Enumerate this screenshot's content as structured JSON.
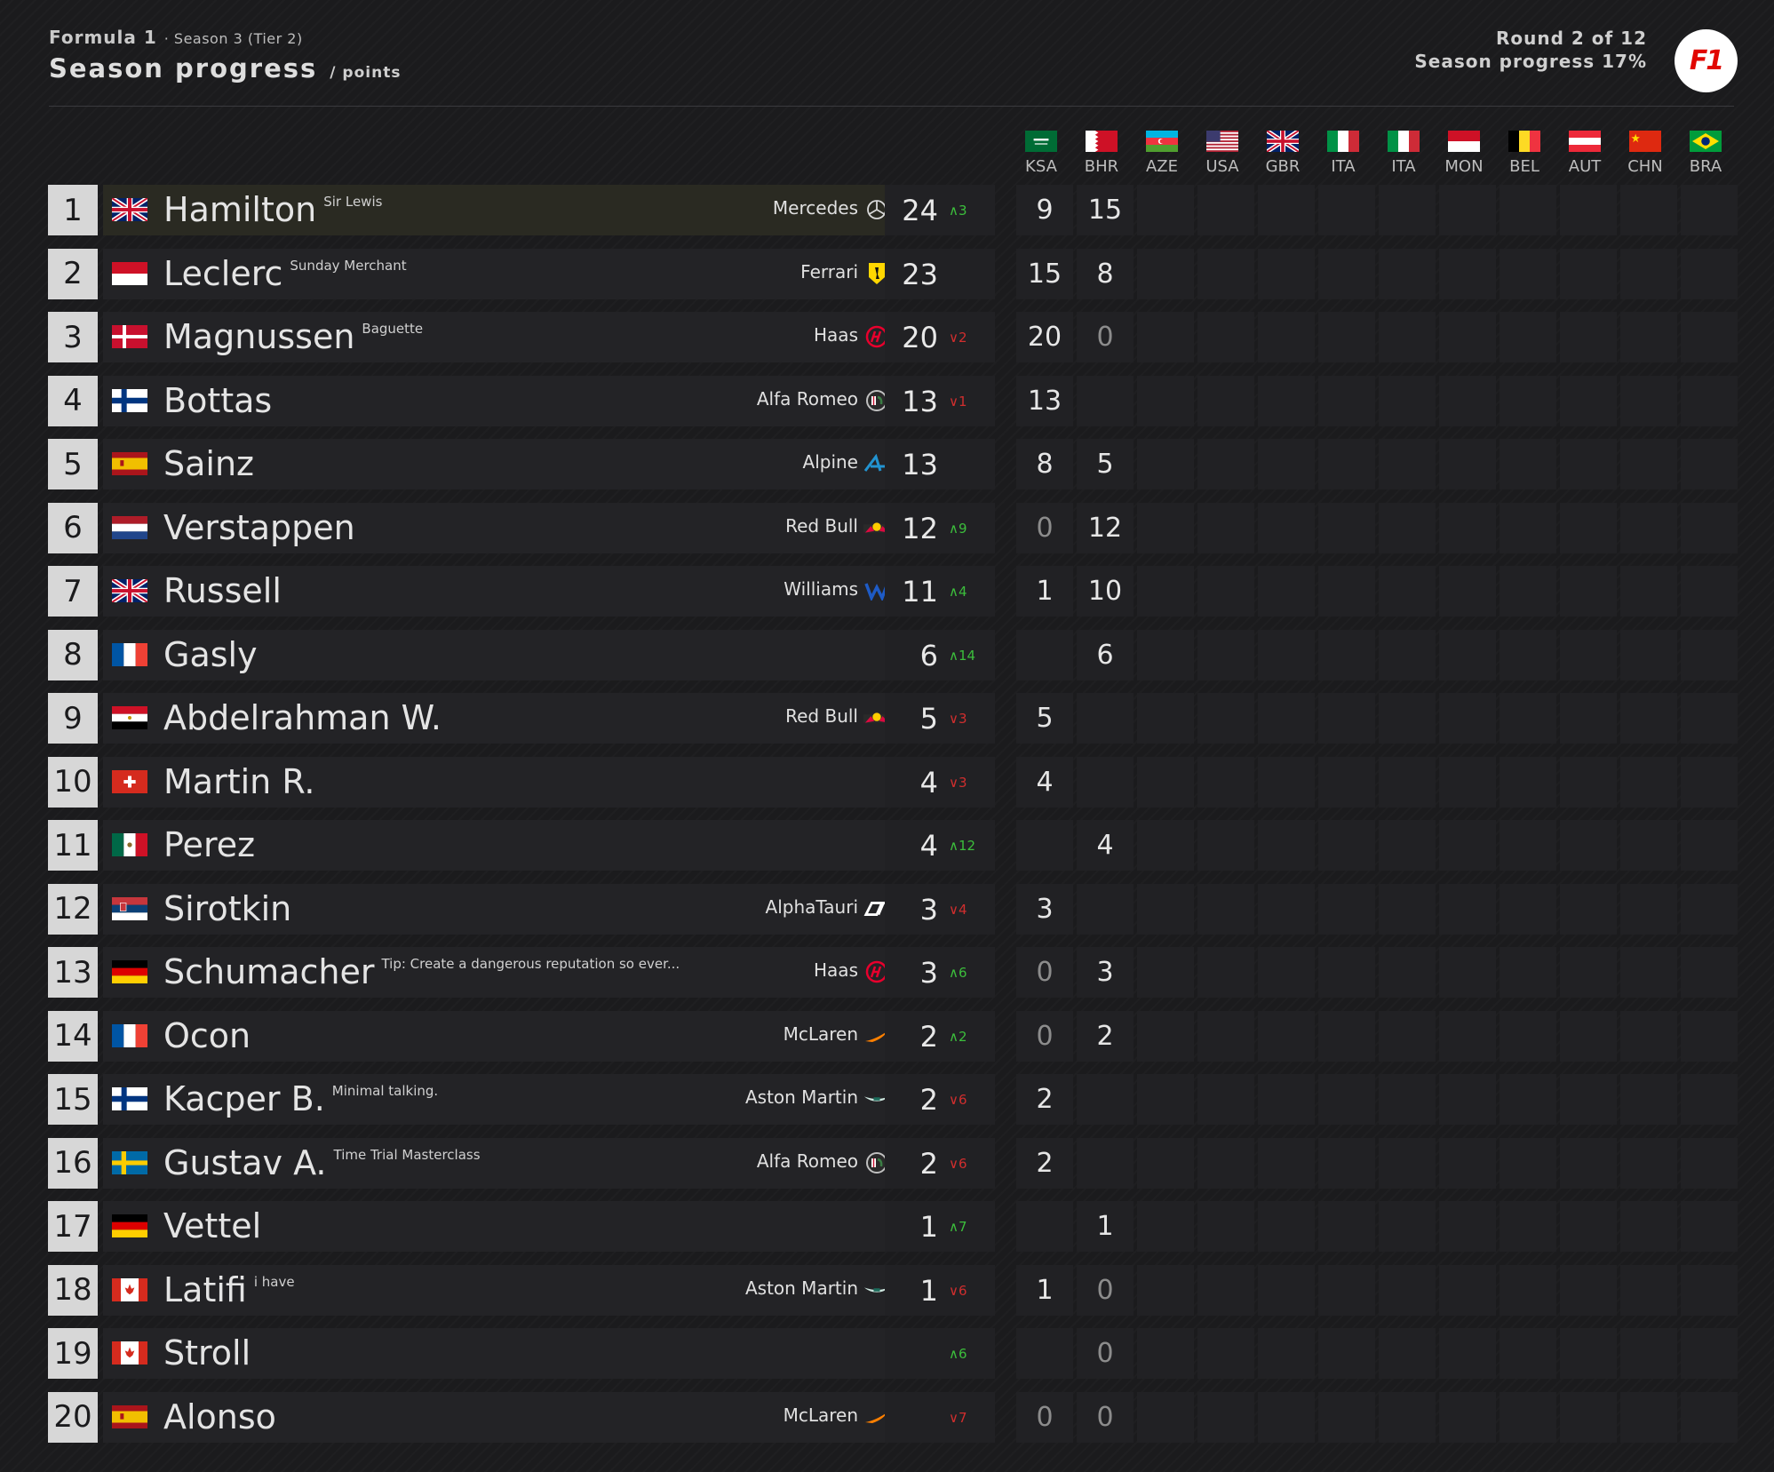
{
  "header": {
    "brand": "Formula 1",
    "season": "· Season 3 (Tier 2)",
    "title": "Season progress",
    "unit": "/ points",
    "round": "Round 2 of 12",
    "progress": "Season progress 17%"
  },
  "logo_text": "F1",
  "races": [
    {
      "code": "KSA",
      "flag": "sau"
    },
    {
      "code": "BHR",
      "flag": "bhr"
    },
    {
      "code": "AZE",
      "flag": "aze"
    },
    {
      "code": "USA",
      "flag": "usa"
    },
    {
      "code": "GBR",
      "flag": "gbr"
    },
    {
      "code": "ITA",
      "flag": "ita"
    },
    {
      "code": "ITA",
      "flag": "ita"
    },
    {
      "code": "MON",
      "flag": "mon"
    },
    {
      "code": "BEL",
      "flag": "bel"
    },
    {
      "code": "AUT",
      "flag": "aut"
    },
    {
      "code": "CHN",
      "flag": "chn"
    },
    {
      "code": "BRA",
      "flag": "bra"
    }
  ],
  "colors": {
    "up": "#3cbe3c",
    "down": "#d02e2e",
    "leader_row": "#2a2a22"
  },
  "drivers": [
    {
      "pos": "1",
      "flag": "gbr",
      "name": "Hamilton",
      "nick": "Sir Lewis",
      "team": "Mercedes",
      "team_icon": "mercedes-icon",
      "total": "24",
      "delta": {
        "dir": "up",
        "value": "3"
      },
      "results": [
        "9",
        "15"
      ]
    },
    {
      "pos": "2",
      "flag": "mon",
      "name": "Leclerc",
      "nick": "Sunday Merchant",
      "team": "Ferrari",
      "team_icon": "ferrari-icon",
      "total": "23",
      "delta": null,
      "results": [
        "15",
        "8"
      ]
    },
    {
      "pos": "3",
      "flag": "den",
      "name": "Magnussen",
      "nick": "Baguette",
      "team": "Haas",
      "team_icon": "haas-icon",
      "total": "20",
      "delta": {
        "dir": "down",
        "value": "2"
      },
      "results": [
        "20",
        "0"
      ]
    },
    {
      "pos": "4",
      "flag": "fin",
      "name": "Bottas",
      "nick": "",
      "team": "Alfa Romeo",
      "team_icon": "alfa-romeo-icon",
      "total": "13",
      "delta": {
        "dir": "down",
        "value": "1"
      },
      "results": [
        "13",
        ""
      ]
    },
    {
      "pos": "5",
      "flag": "esp",
      "name": "Sainz",
      "nick": "",
      "team": "Alpine",
      "team_icon": "alpine-icon",
      "total": "13",
      "delta": null,
      "results": [
        "8",
        "5"
      ]
    },
    {
      "pos": "6",
      "flag": "ned",
      "name": "Verstappen",
      "nick": "",
      "team": "Red Bull",
      "team_icon": "red-bull-icon",
      "total": "12",
      "delta": {
        "dir": "up",
        "value": "9"
      },
      "results": [
        "0",
        "12"
      ]
    },
    {
      "pos": "7",
      "flag": "gbr",
      "name": "Russell",
      "nick": "",
      "team": "Williams",
      "team_icon": "williams-icon",
      "total": "11",
      "delta": {
        "dir": "up",
        "value": "4"
      },
      "results": [
        "1",
        "10"
      ]
    },
    {
      "pos": "8",
      "flag": "fra",
      "name": "Gasly",
      "nick": "",
      "team": "",
      "team_icon": "",
      "total": "6",
      "delta": {
        "dir": "up",
        "value": "14"
      },
      "results": [
        "",
        "6"
      ]
    },
    {
      "pos": "9",
      "flag": "egy",
      "name": "Abdelrahman W.",
      "nick": "",
      "team": "Red Bull",
      "team_icon": "red-bull-icon",
      "total": "5",
      "delta": {
        "dir": "down",
        "value": "3"
      },
      "results": [
        "5",
        ""
      ]
    },
    {
      "pos": "10",
      "flag": "sui",
      "name": "Martin R.",
      "nick": "",
      "team": "",
      "team_icon": "",
      "total": "4",
      "delta": {
        "dir": "down",
        "value": "3"
      },
      "results": [
        "4",
        ""
      ]
    },
    {
      "pos": "11",
      "flag": "mex",
      "name": "Perez",
      "nick": "",
      "team": "",
      "team_icon": "",
      "total": "4",
      "delta": {
        "dir": "up",
        "value": "12"
      },
      "results": [
        "",
        "4"
      ]
    },
    {
      "pos": "12",
      "flag": "srb",
      "name": "Sirotkin",
      "nick": "",
      "team": "AlphaTauri",
      "team_icon": "alphatauri-icon",
      "total": "3",
      "delta": {
        "dir": "down",
        "value": "4"
      },
      "results": [
        "3",
        ""
      ]
    },
    {
      "pos": "13",
      "flag": "ger",
      "name": "Schumacher",
      "nick": "Tip: Create a dangerous reputation so ever...",
      "team": "Haas",
      "team_icon": "haas-icon",
      "total": "3",
      "delta": {
        "dir": "up",
        "value": "6"
      },
      "results": [
        "0",
        "3"
      ]
    },
    {
      "pos": "14",
      "flag": "fra",
      "name": "Ocon",
      "nick": "",
      "team": "McLaren",
      "team_icon": "mclaren-icon",
      "total": "2",
      "delta": {
        "dir": "up",
        "value": "2"
      },
      "results": [
        "0",
        "2"
      ]
    },
    {
      "pos": "15",
      "flag": "fin",
      "name": "Kacper B.",
      "nick": "Minimal talking.",
      "team": "Aston Martin",
      "team_icon": "aston-martin-icon",
      "total": "2",
      "delta": {
        "dir": "down",
        "value": "6"
      },
      "results": [
        "2",
        ""
      ]
    },
    {
      "pos": "16",
      "flag": "swe",
      "name": "Gustav A.",
      "nick": "Time Trial Masterclass",
      "team": "Alfa Romeo",
      "team_icon": "alfa-romeo-icon",
      "total": "2",
      "delta": {
        "dir": "down",
        "value": "6"
      },
      "results": [
        "2",
        ""
      ]
    },
    {
      "pos": "17",
      "flag": "ger",
      "name": "Vettel",
      "nick": "",
      "team": "",
      "team_icon": "",
      "total": "1",
      "delta": {
        "dir": "up",
        "value": "7"
      },
      "results": [
        "",
        "1"
      ]
    },
    {
      "pos": "18",
      "flag": "can",
      "name": "Latifi",
      "nick": "i have",
      "team": "Aston Martin",
      "team_icon": "aston-martin-icon",
      "total": "1",
      "delta": {
        "dir": "down",
        "value": "6"
      },
      "results": [
        "1",
        "0"
      ]
    },
    {
      "pos": "19",
      "flag": "can",
      "name": "Stroll",
      "nick": "",
      "team": "",
      "team_icon": "",
      "total": "",
      "delta": {
        "dir": "up",
        "value": "6"
      },
      "results": [
        "",
        "0"
      ]
    },
    {
      "pos": "20",
      "flag": "esp",
      "name": "Alonso",
      "nick": "",
      "team": "McLaren",
      "team_icon": "mclaren-icon",
      "total": "",
      "delta": {
        "dir": "down",
        "value": "7"
      },
      "results": [
        "0",
        "0"
      ]
    }
  ]
}
